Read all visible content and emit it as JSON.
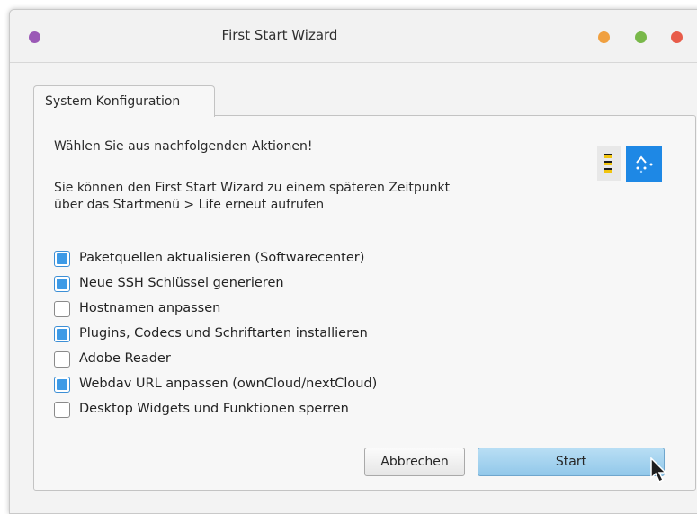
{
  "window": {
    "title": "First Start Wizard",
    "dot_colors": {
      "left": "#9b59b6",
      "orange": "#f0a040",
      "green": "#79b84a",
      "red": "#e85c4a"
    }
  },
  "tab": {
    "label": "System Konfiguration"
  },
  "intro": {
    "heading": "Wählen Sie aus nachfolgenden Aktionen!",
    "line1": "Sie können den First Start Wizard zu einem späteren Zeitpunkt",
    "line2": "über das Startmenü > Life erneut aufrufen"
  },
  "options": [
    {
      "label": "Paketquellen aktualisieren (Softwarecenter)",
      "checked": true
    },
    {
      "label": "Neue SSH Schlüssel generieren",
      "checked": true
    },
    {
      "label": "Hostnamen anpassen",
      "checked": false
    },
    {
      "label": "Plugins, Codecs und Schriftarten installieren",
      "checked": true
    },
    {
      "label": "Adobe Reader",
      "checked": false
    },
    {
      "label": "Webdav URL anpassen (ownCloud/nextCloud)",
      "checked": true
    },
    {
      "label": "Desktop Widgets und Funktionen sperren",
      "checked": false
    }
  ],
  "buttons": {
    "cancel": "Abbrechen",
    "start": "Start"
  },
  "icons": {
    "logo": "app-logo-icon",
    "cursor": "mouse-pointer-icon"
  }
}
